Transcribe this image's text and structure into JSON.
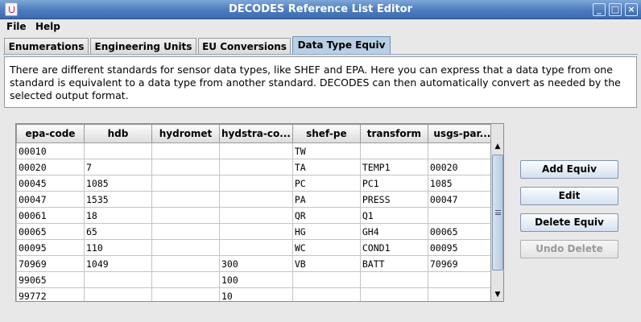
{
  "window": {
    "title": "DECODES Reference List Editor"
  },
  "menu": {
    "items": [
      "File",
      "Help"
    ]
  },
  "tabs": [
    {
      "label": "Enumerations",
      "active": false
    },
    {
      "label": "Engineering Units",
      "active": false
    },
    {
      "label": "EU Conversions",
      "active": false
    },
    {
      "label": "Data Type Equiv",
      "active": true
    }
  ],
  "description": "There are different standards for sensor data types, like SHEF and EPA. Here you can express that a data type from one standard is equivalent to a data type from another standard. DECODES can then automatically convert as needed by the selected output format.",
  "table": {
    "columns": [
      "epa-code",
      "hdb",
      "hydromet",
      "hydstra-co...",
      "shef-pe",
      "transform",
      "usgs-par..."
    ],
    "rows": [
      [
        "00010",
        "",
        "",
        "",
        "TW",
        "",
        ""
      ],
      [
        "00020",
        "7",
        "",
        "",
        "TA",
        "TEMP1",
        "00020"
      ],
      [
        "00045",
        "1085",
        "",
        "",
        "PC",
        "PC1",
        "1085"
      ],
      [
        "00047",
        "1535",
        "",
        "",
        "PA",
        "PRESS",
        "00047"
      ],
      [
        "00061",
        "18",
        "",
        "",
        "QR",
        "Q1",
        ""
      ],
      [
        "00065",
        "65",
        "",
        "",
        "HG",
        "GH4",
        "00065"
      ],
      [
        "00095",
        "110",
        "",
        "",
        "WC",
        "COND1",
        "00095"
      ],
      [
        "70969",
        "1049",
        "",
        "300",
        "VB",
        "BATT",
        "70969"
      ],
      [
        "99065",
        "",
        "",
        "100",
        "",
        "",
        ""
      ],
      [
        "99772",
        "",
        "",
        "10",
        "",
        "",
        ""
      ]
    ]
  },
  "buttons": {
    "add": "Add Equiv",
    "edit": "Edit",
    "delete": "Delete Equiv",
    "undo": "Undo Delete"
  },
  "colors": {
    "titlebar": "#4f7fc0",
    "active_tab": "#b8cfe5"
  }
}
